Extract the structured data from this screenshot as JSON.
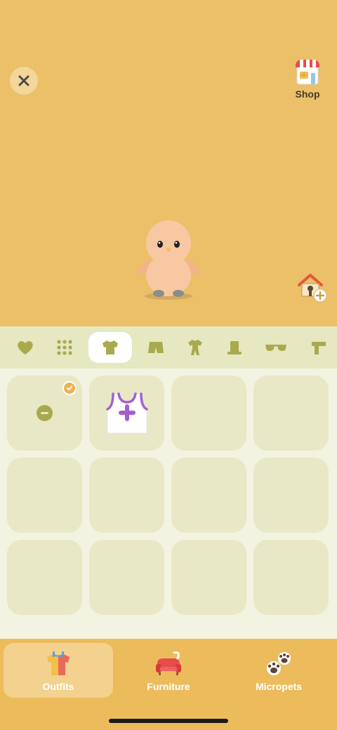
{
  "scene": {
    "close_icon": "close-icon",
    "shop_label": "Shop",
    "shop_icon": "shop-icon",
    "home_add_icon": "home-add-icon",
    "background": "#ecbf69"
  },
  "tabs": [
    {
      "name": "favorites",
      "icon": "heart-icon",
      "active": false
    },
    {
      "name": "all",
      "icon": "grid-icon",
      "active": false
    },
    {
      "name": "tops",
      "icon": "shirt-icon",
      "active": true
    },
    {
      "name": "bottoms",
      "icon": "shorts-icon",
      "active": false
    },
    {
      "name": "outfits",
      "icon": "jumpsuit-icon",
      "active": false
    },
    {
      "name": "hats",
      "icon": "top-hat-icon",
      "active": false
    },
    {
      "name": "glasses",
      "icon": "glasses-icon",
      "active": false
    },
    {
      "name": "scarves",
      "icon": "scarf-icon",
      "active": false
    }
  ],
  "grid": {
    "items": [
      {
        "type": "none",
        "selected": true,
        "icon": "remove-icon"
      },
      {
        "type": "item",
        "icon": "tank-top-icon"
      },
      {
        "type": "empty"
      },
      {
        "type": "empty"
      },
      {
        "type": "empty"
      },
      {
        "type": "empty"
      },
      {
        "type": "empty"
      },
      {
        "type": "empty"
      },
      {
        "type": "empty"
      },
      {
        "type": "empty"
      },
      {
        "type": "empty"
      },
      {
        "type": "empty"
      }
    ]
  },
  "nav": {
    "outfits_label": "Outfits",
    "furniture_label": "Furniture",
    "micropets_label": "Micropets",
    "active": "outfits"
  }
}
